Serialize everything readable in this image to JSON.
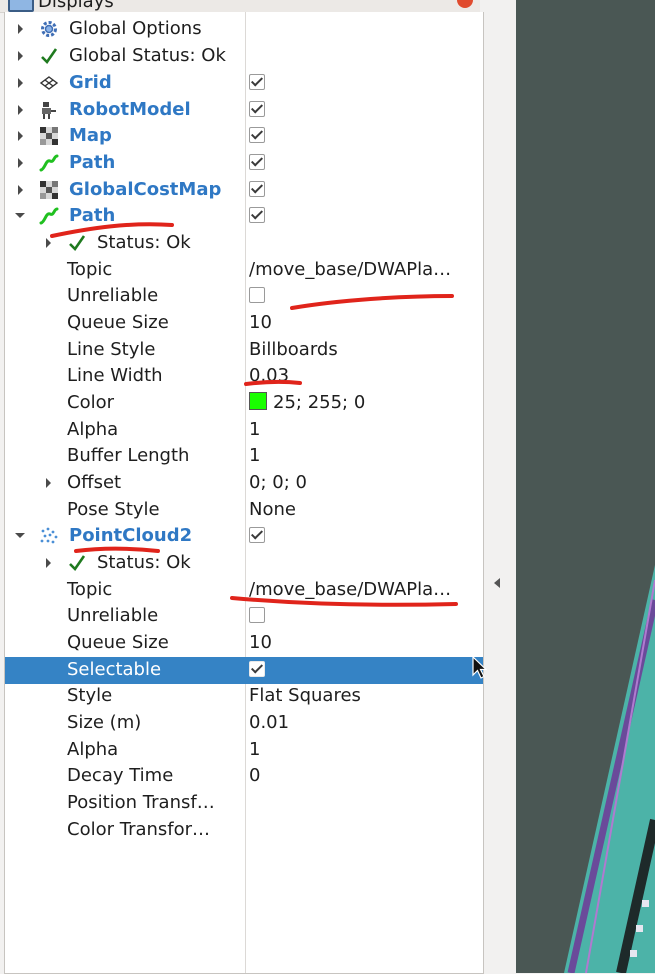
{
  "window": {
    "title": "Displays"
  },
  "displays": [
    {
      "label": "Global Options",
      "icon": "gear-icon",
      "expanded": false
    },
    {
      "label": "Global Status: Ok",
      "icon": "check-icon",
      "expanded": false
    },
    {
      "label": "Grid",
      "icon": "grid-icon",
      "checked": true,
      "expanded": false
    },
    {
      "label": "RobotModel",
      "icon": "robot-icon",
      "checked": true,
      "expanded": false
    },
    {
      "label": "Map",
      "icon": "map-icon",
      "checked": true,
      "expanded": false
    },
    {
      "label": "Path",
      "icon": "path-icon",
      "checked": true,
      "expanded": false
    },
    {
      "label": "GlobalCostMap",
      "icon": "map-icon",
      "checked": true,
      "expanded": false
    },
    {
      "label": "Path",
      "icon": "path-icon",
      "checked": true,
      "expanded": true,
      "status": "Status: Ok",
      "properties": {
        "topic": {
          "label": "Topic",
          "value": "/move_base/DWAPla…"
        },
        "unreliable": {
          "label": "Unreliable",
          "checked": false
        },
        "queue_size": {
          "label": "Queue Size",
          "value": "10"
        },
        "line_style": {
          "label": "Line Style",
          "value": "Billboards"
        },
        "line_width": {
          "label": "Line Width",
          "value": "0.03"
        },
        "color": {
          "label": "Color",
          "value": "25; 255; 0",
          "swatch": "#19ff00"
        },
        "alpha": {
          "label": "Alpha",
          "value": "1"
        },
        "buffer_length": {
          "label": "Buffer Length",
          "value": "1"
        },
        "offset": {
          "label": "Offset",
          "value": "0; 0; 0"
        },
        "pose_style": {
          "label": "Pose Style",
          "value": "None"
        }
      }
    },
    {
      "label": "PointCloud2",
      "icon": "pointcloud-icon",
      "checked": true,
      "expanded": true,
      "status": "Status: Ok",
      "properties": {
        "topic": {
          "label": "Topic",
          "value": "/move_base/DWAPla…"
        },
        "unreliable": {
          "label": "Unreliable",
          "checked": false
        },
        "queue_size": {
          "label": "Queue Size",
          "value": "10"
        },
        "selectable": {
          "label": "Selectable",
          "checked": true
        },
        "style": {
          "label": "Style",
          "value": "Flat Squares"
        },
        "size": {
          "label": "Size (m)",
          "value": "0.01"
        },
        "alpha": {
          "label": "Alpha",
          "value": "1"
        },
        "decay_time": {
          "label": "Decay Time",
          "value": "0"
        },
        "position_transformer": {
          "label": "Position Transf…",
          "value": ""
        },
        "color_transformer": {
          "label": "Color Transfor…",
          "value": ""
        }
      }
    }
  ],
  "colors": {
    "accent": "#2f78c4",
    "selection": "#3583c5",
    "annotation": "#e0241b",
    "status_ok": "#1f7a1f"
  }
}
